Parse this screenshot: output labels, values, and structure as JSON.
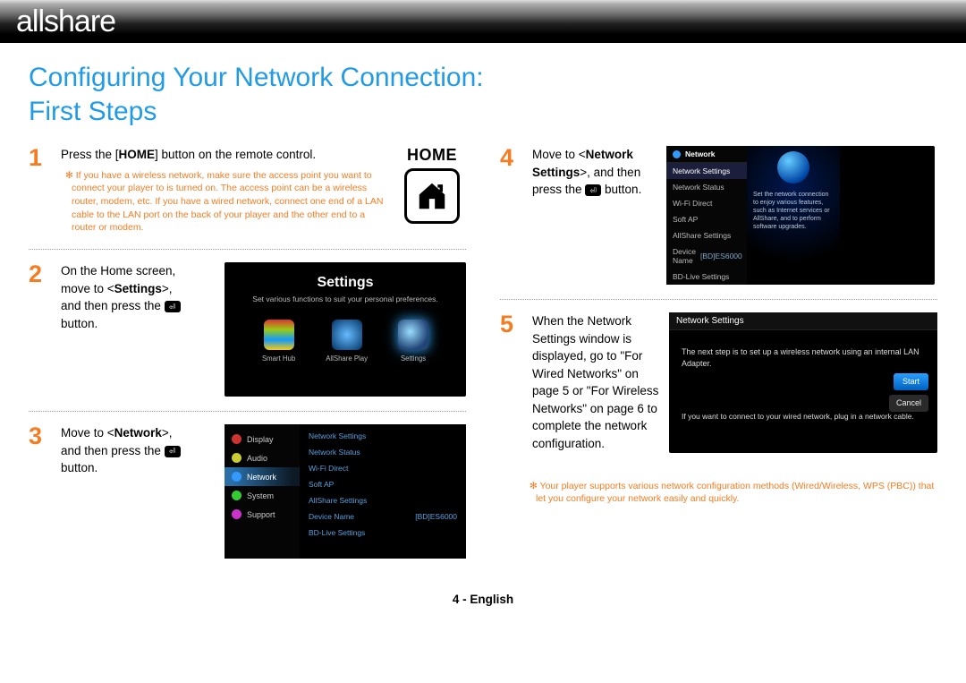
{
  "logo": "allshare",
  "title_line1": "Configuring Your Network Connection:",
  "title_line2": "First Steps",
  "home_badge_label": "HOME",
  "steps": {
    "s1": {
      "num": "1",
      "text_a": "Press the [",
      "text_b": "HOME",
      "text_c": "] button on the remote control.",
      "note": "If you have a wireless network, make sure the access point you want to connect your player to is turned on. The access point can be a wireless router, modem, etc. If you have a wired network, connect one end of a LAN cable to the LAN port on the back of your player and the other end to a router or modem."
    },
    "s2": {
      "num": "2",
      "text_a": "On the Home screen, move to <",
      "text_b": "Settings",
      "text_c": ">, and then press the ",
      "text_d": " button."
    },
    "s3": {
      "num": "3",
      "text_a": "Move to <",
      "text_b": "Network",
      "text_c": ">, and then press the ",
      "text_d": " button."
    },
    "s4": {
      "num": "4",
      "text_a": "Move to <",
      "text_b": "Network Settings",
      "text_c": ">, and then press the ",
      "text_d": " button."
    },
    "s5": {
      "num": "5",
      "text": "When the Network Settings window is displayed, go to \"For Wired Networks\" on page 5 or \"For Wireless Networks\" on page 6 to complete the network configuration."
    }
  },
  "settings_shot": {
    "title": "Settings",
    "subtitle": "Set various functions to suit your personal preferences.",
    "apps": [
      "Smart Hub",
      "AllShare Play",
      "Settings"
    ]
  },
  "network_shot": {
    "side": [
      "Display",
      "Audio",
      "Network",
      "System",
      "Support"
    ],
    "main": [
      "Network Settings",
      "Network Status",
      "Wi-Fi Direct",
      "Soft AP",
      "AllShare Settings",
      "Device Name",
      "BD-Live Settings"
    ],
    "device_value": "[BD]ES6000"
  },
  "nw2_shot": {
    "panel": "Network",
    "side": [
      "Network Settings",
      "Network Status",
      "Wi-Fi Direct",
      "Soft AP",
      "AllShare Settings",
      "Device Name",
      "BD-Live Settings"
    ],
    "device_value": "[BD]ES6000",
    "desc": "Set the network connection to enjoy various features, such as Internet services or AllShare, and to perform software upgrades."
  },
  "wiz_shot": {
    "panel": "Network Settings",
    "body1": "The next step is to set up a wireless network using an internal LAN Adapter.",
    "body2": "If you want to connect to your wired network, plug in a network cable.",
    "start": "Start",
    "cancel": "Cancel"
  },
  "global_note": "Your player supports various network configuration methods (Wired/Wireless, WPS (PBC)) that let you configure your network easily and quickly.",
  "footer": "4 - English"
}
